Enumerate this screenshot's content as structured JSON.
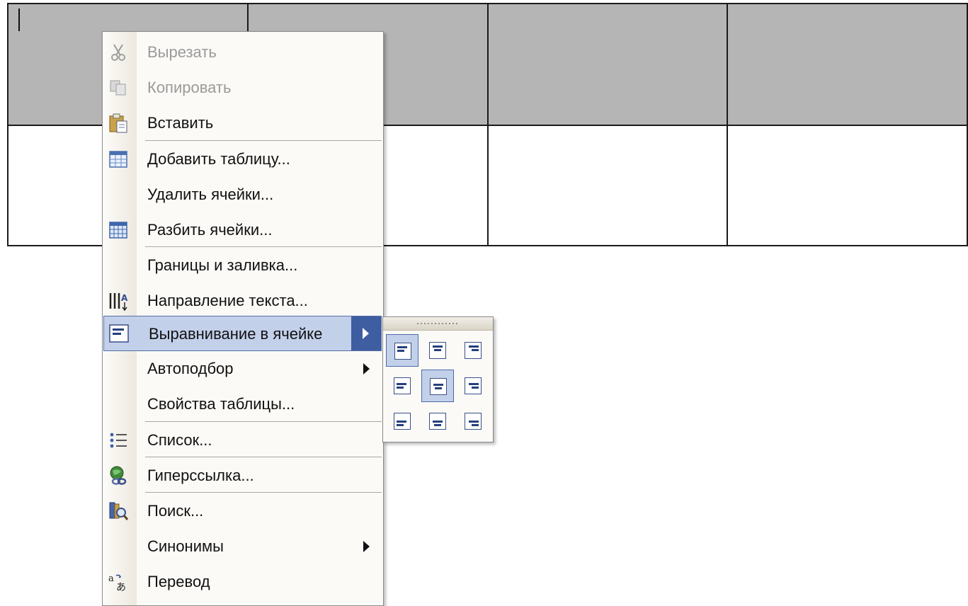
{
  "document": {
    "table": {
      "rows": 2,
      "cols": 4
    }
  },
  "context_menu": {
    "items": [
      {
        "label": "Вырезать",
        "icon": "scissors-icon",
        "disabled": true
      },
      {
        "label": "Копировать",
        "icon": "copy-icon",
        "disabled": true
      },
      {
        "label": "Вставить",
        "icon": "paste-icon"
      },
      {
        "label": "Добавить таблицу...",
        "icon": "insert-table-icon"
      },
      {
        "label": "Удалить ячейки...",
        "icon": ""
      },
      {
        "label": "Разбить ячейки...",
        "icon": "split-cells-icon"
      },
      {
        "label": "Границы и заливка...",
        "icon": ""
      },
      {
        "label": "Направление текста...",
        "icon": "text-direction-icon"
      },
      {
        "label": "Выравнивание в ячейке",
        "icon": "cell-align-icon",
        "highlighted": true,
        "submenu": true
      },
      {
        "label": "Автоподбор",
        "icon": "",
        "submenu": true
      },
      {
        "label": "Свойства таблицы...",
        "icon": ""
      },
      {
        "label": "Список...",
        "icon": "bullet-list-icon"
      },
      {
        "label": "Гиперссылка...",
        "icon": "hyperlink-icon"
      },
      {
        "label": "Поиск...",
        "icon": "research-icon"
      },
      {
        "label": "Синонимы",
        "icon": "",
        "submenu": true
      },
      {
        "label": "Перевод",
        "icon": "translate-icon"
      }
    ]
  },
  "align_submenu": {
    "options": [
      {
        "name": "align-top-left",
        "selected": true
      },
      {
        "name": "align-top-center"
      },
      {
        "name": "align-top-right"
      },
      {
        "name": "align-middle-left"
      },
      {
        "name": "align-middle-center",
        "selected": true
      },
      {
        "name": "align-middle-right"
      },
      {
        "name": "align-bottom-left"
      },
      {
        "name": "align-bottom-center"
      },
      {
        "name": "align-bottom-right"
      }
    ]
  }
}
